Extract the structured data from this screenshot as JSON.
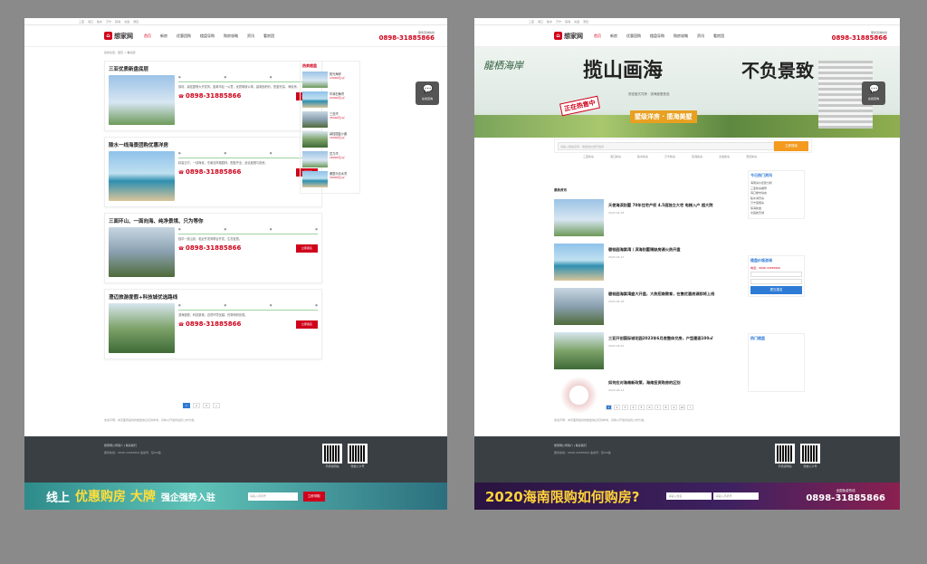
{
  "left": {
    "logo": "想家网",
    "nav": [
      "首页",
      "新房",
      "优惠团购",
      "楼盘导购",
      "购房攻略",
      "资讯",
      "看房团"
    ],
    "hotline_label": "服务咨询热线",
    "hotline": "0898-31885866",
    "breadcrumb": "您的位置：首页 > 看房团",
    "cards": [
      {
        "title": "三亚优质新盘底层",
        "desc": "保利、碧桂园等大开发商，距离市区一公里，优质稀缺公寓，建筑面积约，配套完善，海景房。",
        "phone": "0898-31885866",
        "btn": "立即报名"
      },
      {
        "title": "陵水一线海景团购优惠洋房",
        "desc": "精装交付、一线海景，东南亚风格园林，配套齐全，适合度假与投资。",
        "phone": "0898-31885866",
        "btn": "立即报名"
      },
      {
        "title": "三面环山、一面向海、纯净景境、只为等你",
        "desc": "独享一线山景，临近开发商联合开发，生态宜居。",
        "phone": "0898-31885866",
        "btn": "立即报名"
      },
      {
        "title": "澄迈旅游度假+科技城优选路线",
        "desc": "滨海度假、科技新城，自然环境优越，热带雨林景观。",
        "phone": "0898-31885866",
        "btn": "立即报名"
      }
    ],
    "side_title": "热卖楼盘",
    "side_items": [
      {
        "t": "阳光海岸",
        "p": "13000元/㎡"
      },
      {
        "t": "华润石梅湾",
        "p": "22000元/㎡"
      },
      {
        "t": "三亚湾",
        "p": "35000元/㎡"
      },
      {
        "t": "碧桂园金沙滩",
        "p": "15000元/㎡"
      },
      {
        "t": "富力湾",
        "p": "18000元/㎡"
      },
      {
        "t": "雅居乐清水湾",
        "p": "30000元/㎡"
      }
    ],
    "pages": [
      "1",
      "2",
      "3",
      "»"
    ],
    "footer_text": "免责声明：本页面所提供的楼盘信息仅供参考，具体以开发商最终公布为准。",
    "footer_links": "想家网公司简介 | 联系我们",
    "footer_info": "服务热线：0898-31885866 备案号：琼ICP备",
    "qr_labels": [
      "手机版网站",
      "微信公众号"
    ],
    "promo": {
      "a": "线上",
      "b": "优惠购房 大牌",
      "c": "强企强势入驻",
      "input": "请输入手机号",
      "go": "立即领取"
    },
    "chat": "在线咨询"
  },
  "right": {
    "banner_logo": "龍栖海岸",
    "banner_t1": "揽山画海",
    "banner_t2": "不负景致",
    "banner_sub": "低密度式洋房 · 滨海度假首选",
    "banner_seal": "正在热售中",
    "banner_tag": "墅级洋房 · 揽海美墅",
    "search_placeholder": "请输入楼盘名称、楼盘地址或开发商",
    "search_btn": "立即搜索",
    "quick": [
      "三亚新房",
      "海口新房",
      "陵水新房",
      "万宁新房",
      "琼海新房",
      "文昌新房",
      "澄迈新房"
    ],
    "news_title": "最新资讯",
    "news": [
      {
        "t": "天使海滨别墅 70年住宅产权 4.5层独立大宅 电梯入户 超大院",
        "d": "2023-04-18"
      },
      {
        "t": "碧桂园海棠湾丨滨海别墅稀缺房源火热开盘",
        "d": "2023-04-17"
      },
      {
        "t": "碧桂园海棠湾盛大开盘，大热招商教育，在售优惠房源即将上线",
        "d": "2023-04-16"
      },
      {
        "t": "三亚开创国际城花园2023年6月底整体交房，户型建面100㎡",
        "d": "2023-04-15"
      },
      {
        "t": "如何应对海南新政策，海南投资购房的区别",
        "d": "2023-04-14"
      }
    ],
    "hot_title": "今日热门资讯",
    "hot_list": [
      "海南房价走势分析",
      "三亚新房推荐",
      "海口楼市动态",
      "陵水海景房",
      "万宁度假房",
      "琼海新盘",
      "文昌航天城"
    ],
    "form_title": "楼盘价格咨询",
    "form_phone": "电话：0898-31885866",
    "form_btn": "提交报名",
    "rank_title": "热门楼盘",
    "pages": [
      "1",
      "2",
      "3",
      "4",
      "5",
      "6",
      "7",
      "8",
      "9",
      "10",
      "»"
    ],
    "promo": {
      "a": "2020海南限购如何购房?",
      "input1": "请输入姓名",
      "input2": "请输入手机号",
      "call_label": "全国免费热线",
      "call": "0898-31885866"
    },
    "chat": "在线咨询"
  }
}
